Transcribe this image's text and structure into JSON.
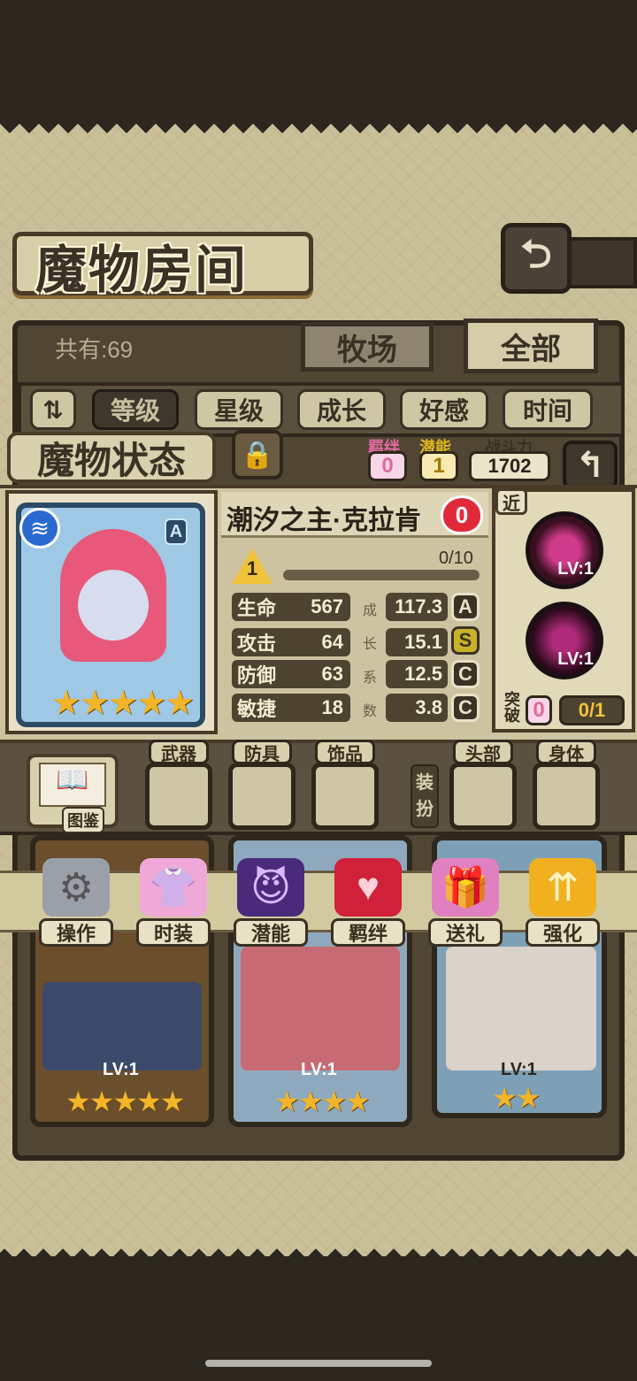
{
  "header": {
    "title": "魔物房间",
    "back_icon": "return-arrow-icon"
  },
  "collection": {
    "count_label": "共有:69",
    "tabs": [
      {
        "label": "牧场",
        "selected": false
      },
      {
        "label": "全部",
        "selected": true
      }
    ],
    "sort_options": [
      {
        "label": "等级",
        "selected": true
      },
      {
        "label": "星级",
        "selected": false
      },
      {
        "label": "成长",
        "selected": false
      },
      {
        "label": "好感",
        "selected": false
      },
      {
        "label": "时间",
        "selected": false
      }
    ]
  },
  "status": {
    "title": "魔物状态",
    "badges": [
      {
        "label": "羁绊",
        "value": "0",
        "color": "#e06aa0"
      },
      {
        "label": "潜能",
        "value": "1",
        "color": "#e0b820"
      }
    ],
    "power": {
      "label": "战斗力",
      "value": "1702"
    },
    "monster": {
      "name": "潮汐之主·克拉肯",
      "bond_level": "0",
      "element_icon": "water-wave-icon",
      "rank_letter": "A",
      "stars": 5,
      "level": "1",
      "exp": "0/10",
      "exp_fraction": 0
    },
    "stats": [
      {
        "name": "生命",
        "value": "567",
        "growth": "117.3",
        "grade": "A"
      },
      {
        "name": "攻击",
        "value": "64",
        "growth": "15.1",
        "grade": "S"
      },
      {
        "name": "防御",
        "value": "63",
        "growth": "12.5",
        "grade": "C"
      },
      {
        "name": "敏捷",
        "value": "18",
        "growth": "3.8",
        "grade": "C"
      }
    ],
    "growth_label": [
      "成",
      "长",
      "系",
      "数"
    ],
    "skill_type": "近",
    "skills": [
      {
        "name": "tentacle-skill-icon",
        "level": "LV:1"
      },
      {
        "name": "whirlpool-skill-icon",
        "level": "LV:1"
      }
    ],
    "breakthrough": {
      "label": "突破",
      "count": "0",
      "progress": "0/1"
    }
  },
  "equipment": {
    "guide_label": "图鉴",
    "dress_label": "装扮",
    "slots": [
      "武器",
      "防具",
      "饰品"
    ],
    "dress_slots": [
      "头部",
      "身体"
    ]
  },
  "actions": [
    {
      "label": "操作",
      "icon": "gear-icon"
    },
    {
      "label": "时装",
      "icon": "outfit-icon"
    },
    {
      "label": "潜能",
      "icon": "demon-icon"
    },
    {
      "label": "羁绊",
      "icon": "hearts-icon"
    },
    {
      "label": "送礼",
      "icon": "gift-icon"
    },
    {
      "label": "强化",
      "icon": "upgrade-arrows-icon"
    }
  ],
  "cards": [
    {
      "level": "LV:1",
      "stars": "★★★★★"
    },
    {
      "level": "LV:1",
      "stars": "★★★★"
    },
    {
      "level": "LV:1",
      "stars": "★★"
    }
  ],
  "colors": {
    "frame_dark": "#2f271c",
    "parchment": "#cdc3a0",
    "accent_pink": "#e06aa0",
    "accent_gold": "#e0b820"
  }
}
